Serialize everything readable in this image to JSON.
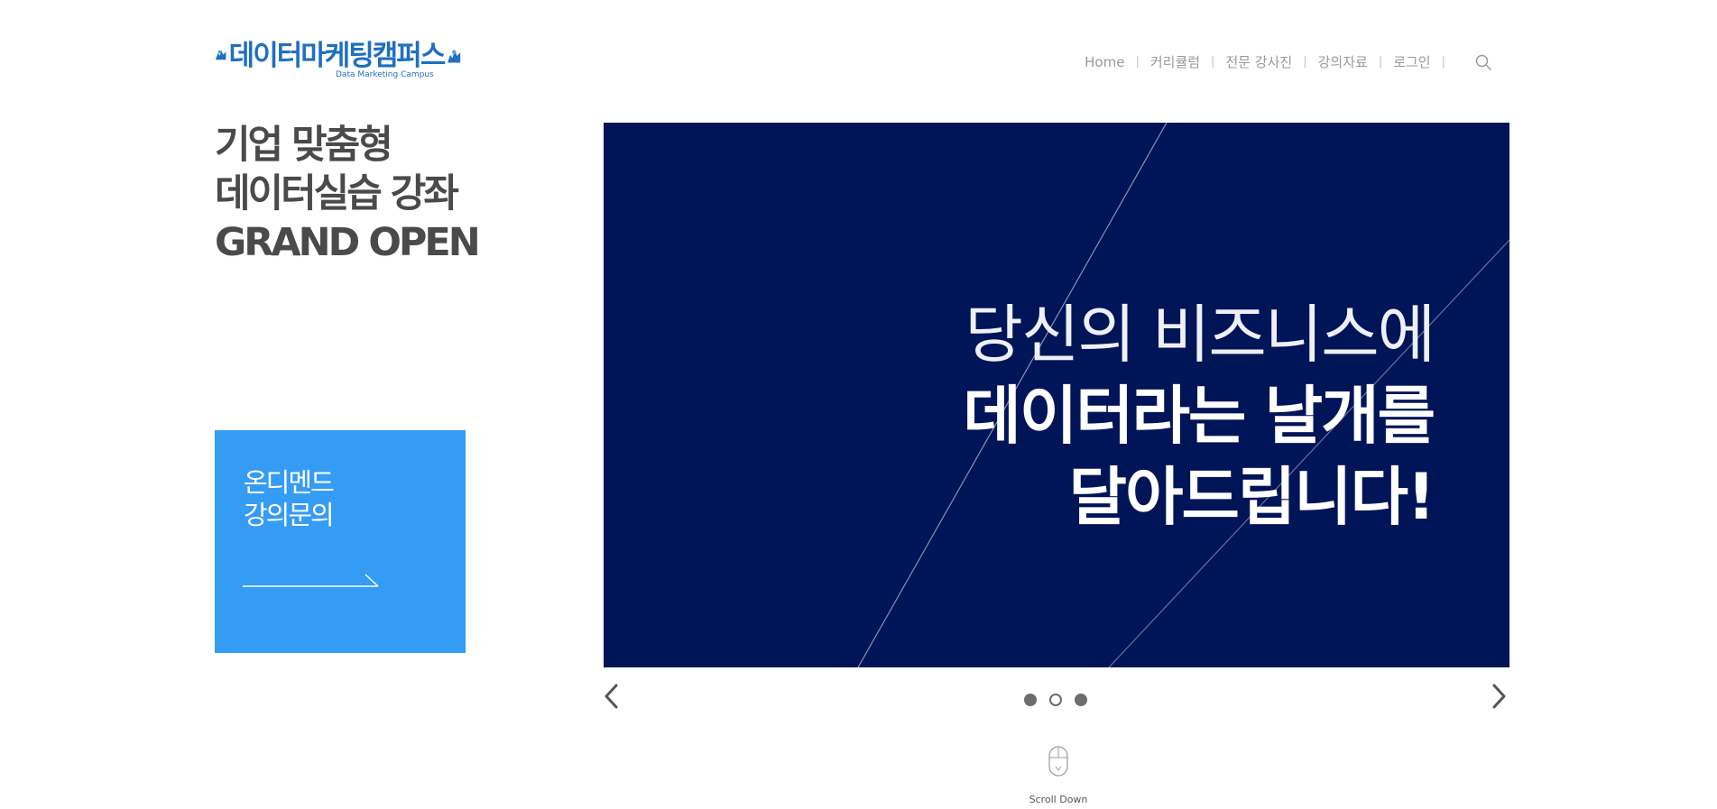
{
  "logo": {
    "main": "데이터마케팅캠퍼스",
    "sub": "Data Marketing Campus",
    "color": "#1f6fc2"
  },
  "nav": {
    "items": [
      "Home",
      "커리큘럼",
      "전문 강사진",
      "강의자료",
      "로그인"
    ],
    "search_icon": "search-icon"
  },
  "headline": {
    "line1": "기업 맞춤형",
    "line2": "데이터실습 강좌",
    "line3": "GRAND OPEN"
  },
  "inquiry": {
    "line1": "온디멘드",
    "line2": "강의문의",
    "color": "#359cf5",
    "arrow_icon": "long-arrow-right-icon"
  },
  "slider": {
    "background": "#001458",
    "line1": "당신의 비즈니스에",
    "line2": "데이터라는 날개를",
    "line3": "달아드립니다!",
    "dots": [
      "filled",
      "hollow",
      "filled"
    ],
    "active_index": 1
  },
  "scroll": {
    "label": "Scroll Down"
  }
}
